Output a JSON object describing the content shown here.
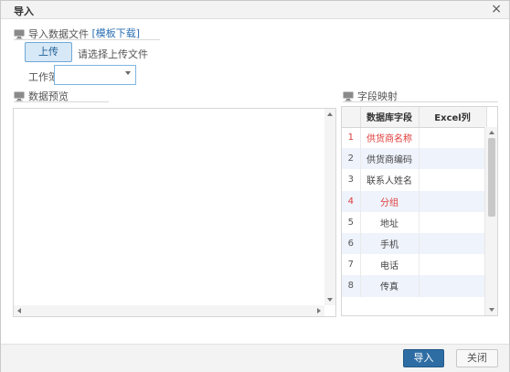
{
  "dialog": {
    "title": "导入",
    "close_icon": "×"
  },
  "import_section": {
    "title": "导入数据文件",
    "template_link": "[模板下载]"
  },
  "upload": {
    "button_label": "上传",
    "hint": "请选择上传文件"
  },
  "workbook": {
    "label": "工作簿",
    "selected_value": ""
  },
  "preview_section": {
    "title": "数据预览"
  },
  "mapping_section": {
    "title": "字段映射",
    "columns": [
      "数据库字段",
      "Excel列"
    ],
    "rows": [
      {
        "index": "1",
        "field": "供货商名称",
        "excel": "",
        "required": true
      },
      {
        "index": "2",
        "field": "供货商编码",
        "excel": "",
        "required": false
      },
      {
        "index": "3",
        "field": "联系人姓名",
        "excel": "",
        "required": false
      },
      {
        "index": "4",
        "field": "分组",
        "excel": "",
        "required": true
      },
      {
        "index": "5",
        "field": "地址",
        "excel": "",
        "required": false
      },
      {
        "index": "6",
        "field": "手机",
        "excel": "",
        "required": false
      },
      {
        "index": "7",
        "field": "电话",
        "excel": "",
        "required": false
      },
      {
        "index": "8",
        "field": "传真",
        "excel": "",
        "required": false
      }
    ]
  },
  "footer": {
    "import_label": "导入",
    "close_label": "关闭"
  },
  "colors": {
    "accent": "#2e6da4",
    "required": "#e03a3a",
    "row_alt": "#eef3fc"
  }
}
